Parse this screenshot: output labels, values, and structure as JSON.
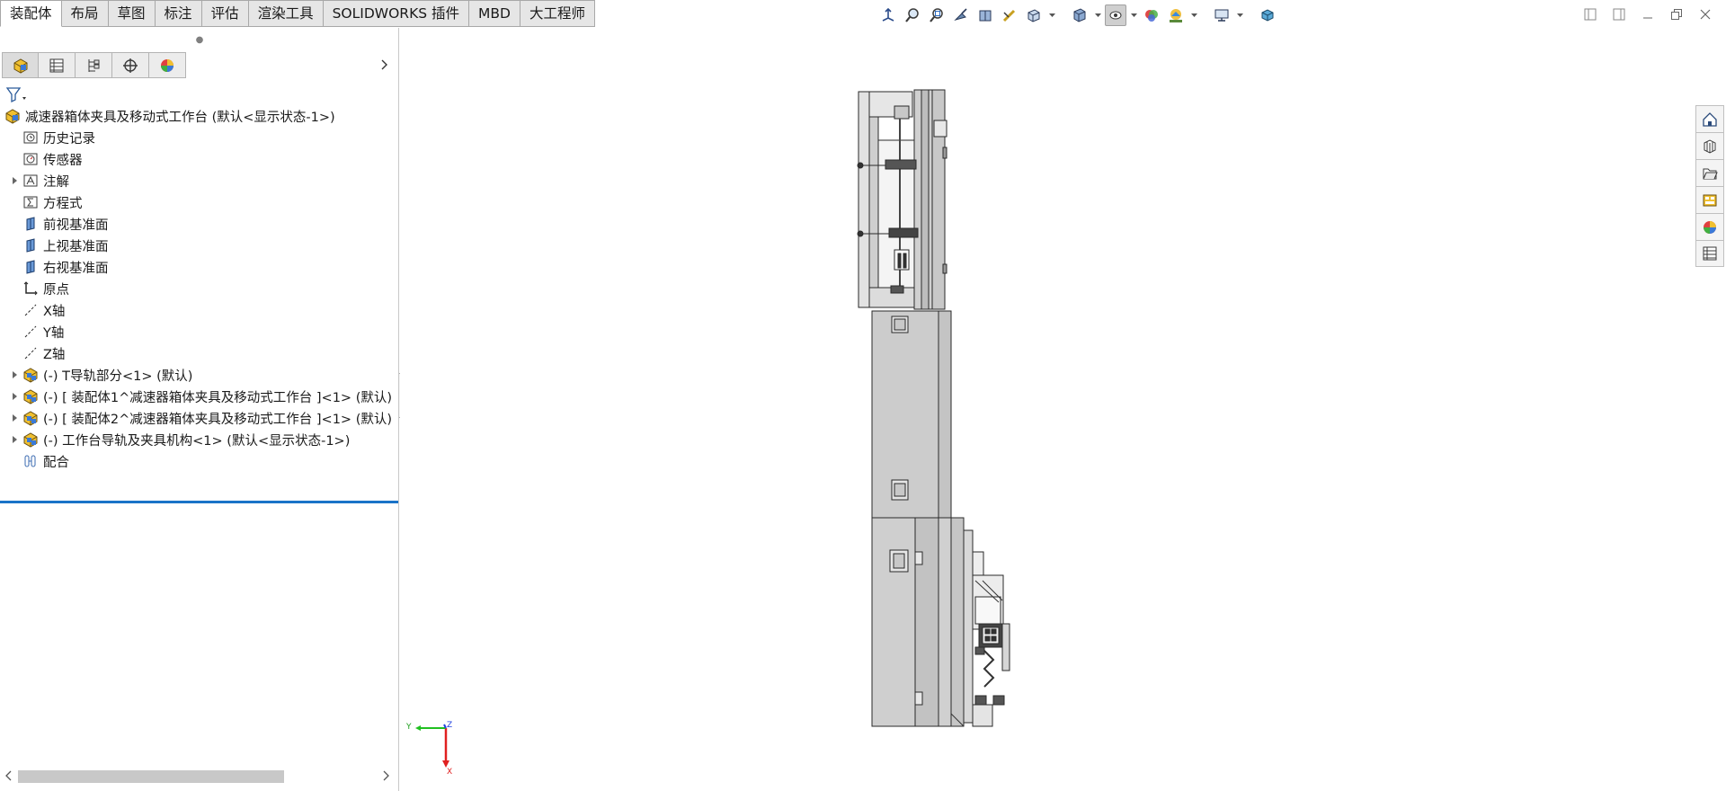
{
  "command_tabs": {
    "items": [
      {
        "label": "装配体",
        "active": true
      },
      {
        "label": "布局"
      },
      {
        "label": "草图"
      },
      {
        "label": "标注"
      },
      {
        "label": "评估"
      },
      {
        "label": "渲染工具"
      },
      {
        "label": "SOLIDWORKS 插件"
      },
      {
        "label": "MBD"
      },
      {
        "label": "大工程师"
      }
    ]
  },
  "heads_up_toolbar": {
    "icons": [
      "view-orientation-icon",
      "zoom-to-fit-icon",
      "zoom-to-area-icon",
      "previous-view-icon",
      "section-view-icon",
      "dynamic-annotation-icon",
      "view-orientation-dropdown-icon",
      "display-style-icon",
      "hide-show-icon",
      "edit-appearance-icon",
      "apply-scene-icon",
      "view-settings-icon",
      "3d-view-icon"
    ]
  },
  "feature_tree": {
    "panel_tabs": [
      "featuremanager-tab",
      "propertymanager-tab",
      "configurationmanager-tab",
      "dimxpert-tab",
      "displaymanager-tab"
    ],
    "items": [
      {
        "label": "减速器箱体夹具及移动式工作台  (默认<显示状态-1>)",
        "icon": "assembly-icon",
        "level": 0,
        "expandable": false
      },
      {
        "label": "历史记录",
        "icon": "history-icon",
        "level": 1,
        "expandable": false
      },
      {
        "label": "传感器",
        "icon": "sensor-icon",
        "level": 1,
        "expandable": false
      },
      {
        "label": "注解",
        "icon": "annotation-icon",
        "level": 1,
        "expandable": true
      },
      {
        "label": "方程式",
        "icon": "equation-icon",
        "level": 1,
        "expandable": false
      },
      {
        "label": "前视基准面",
        "icon": "plane-icon",
        "level": 1,
        "expandable": false
      },
      {
        "label": "上视基准面",
        "icon": "plane-icon",
        "level": 1,
        "expandable": false
      },
      {
        "label": "右视基准面",
        "icon": "plane-icon",
        "level": 1,
        "expandable": false
      },
      {
        "label": "原点",
        "icon": "origin-icon",
        "level": 1,
        "expandable": false
      },
      {
        "label": "X轴",
        "icon": "axis-icon",
        "level": 1,
        "expandable": false
      },
      {
        "label": "Y轴",
        "icon": "axis-icon",
        "level": 1,
        "expandable": false
      },
      {
        "label": "Z轴",
        "icon": "axis-icon",
        "level": 1,
        "expandable": false
      },
      {
        "label": "(-) T导轨部分<1> (默认)",
        "icon": "subassembly-icon",
        "level": 1,
        "expandable": true
      },
      {
        "label": "(-) [ 装配体1^减速器箱体夹具及移动式工作台 ]<1> (默认)",
        "icon": "subassembly-icon",
        "level": 1,
        "expandable": true
      },
      {
        "label": "(-) [ 装配体2^减速器箱体夹具及移动式工作台 ]<1> (默认)",
        "icon": "subassembly-icon",
        "level": 1,
        "expandable": true
      },
      {
        "label": "(-) 工作台导轨及夹具机构<1> (默认<显示状态-1>)",
        "icon": "subassembly-icon",
        "level": 1,
        "expandable": true
      },
      {
        "label": "配合",
        "icon": "mates-icon",
        "level": 1,
        "expandable": false
      }
    ]
  },
  "task_pane": {
    "icons": [
      "solidworks-resources-icon",
      "design-library-icon",
      "file-explorer-icon",
      "view-palette-icon",
      "appearances-icon",
      "custom-properties-icon"
    ]
  },
  "triad": {
    "x_label": "X",
    "y_label": "Y",
    "z_label": "Z"
  },
  "colors": {
    "accent": "#1a73c8",
    "triad_x": "#e02020",
    "triad_y": "#20c020",
    "triad_z": "#2040e0"
  }
}
